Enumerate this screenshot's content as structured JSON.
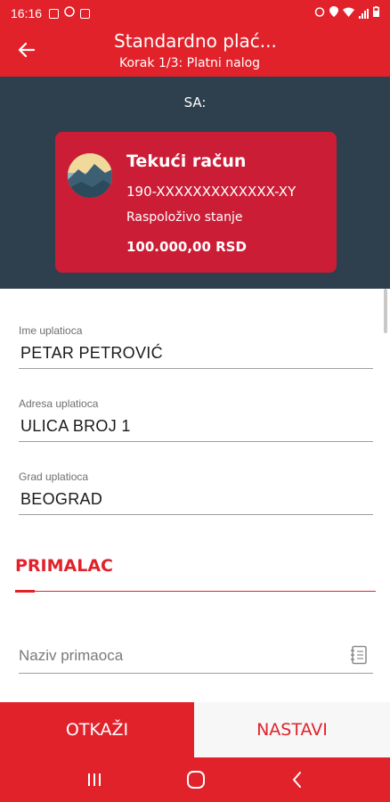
{
  "status_bar": {
    "time": "16:16"
  },
  "app_bar": {
    "title": "Standardno plać...",
    "subtitle": "Korak 1/3: Platni nalog"
  },
  "from_section": {
    "label": "SA:",
    "account": {
      "name": "Tekući račun",
      "number": "190-XXXXXXXXXXXXX-XY",
      "balance_label": "Raspoloživo stanje",
      "balance": "100.000,00 RSD"
    }
  },
  "form": {
    "payer_name": {
      "label": "Ime uplatioca",
      "value": "PETAR PETROVIĆ"
    },
    "payer_address": {
      "label": "Adresa uplatioca",
      "value": "ULICA BROJ 1"
    },
    "payer_city": {
      "label": "Grad uplatioca",
      "value": "BEOGRAD"
    },
    "recipient_section_title": "PRIMALAC",
    "recipient_name": {
      "placeholder": "Naziv primaoca"
    }
  },
  "actions": {
    "cancel_label": "OTKAŽI",
    "next_label": "NASTAVI"
  },
  "colors": {
    "brand_red": "#e2222b",
    "card_red": "#cc1d37",
    "header_dark": "#2e3f4e"
  },
  "icons": {
    "back": "arrow-left-icon",
    "contacts": "contacts-book-icon",
    "nav_recents": "recents-icon",
    "nav_home": "home-icon",
    "nav_back": "back-chevron-icon"
  }
}
